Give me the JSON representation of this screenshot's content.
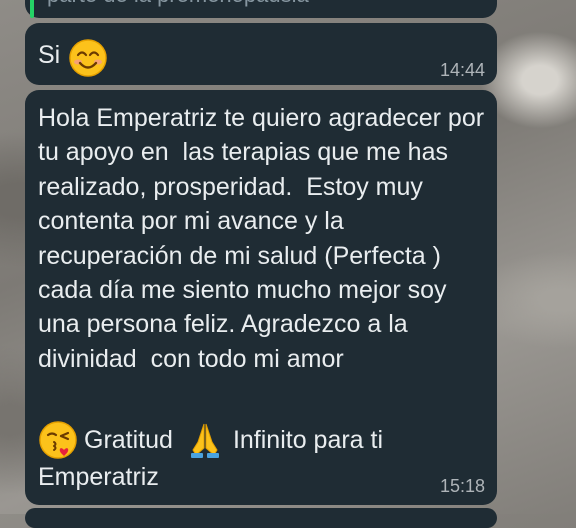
{
  "previous_message": {
    "quoted_text": "parte de la premenopausia"
  },
  "messages": [
    {
      "text": "Si",
      "emoji": "smiling-face-emoji",
      "time": "14:44"
    },
    {
      "text": "Hola Emperatriz te quiero agradecer por tu apoyo en  las terapias que me has realizado, prosperidad.  Estoy muy contenta por mi avance y la recuperación de mi salud (Perfecta )  cada día me siento mucho mejor soy una persona feliz. Agradezco a la divinidad  con todo mi amor",
      "line_gratitud": "Gratitud",
      "line_infinito": "Infinito para ti",
      "line_end": "Emperatriz",
      "emoji_kiss": "face-blowing-kiss-emoji",
      "emoji_pray": "folded-hands-emoji",
      "time": "15:18"
    }
  ],
  "colors": {
    "bubble": "#1f2c34",
    "text": "#e9edef",
    "time": "#aeb4b8",
    "accent": "#25d366"
  }
}
